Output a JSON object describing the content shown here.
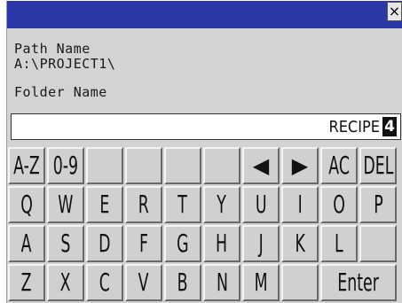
{
  "window": {
    "close_label": "×"
  },
  "path": {
    "label": "Path Name",
    "value": "A:\\PROJECT1\\"
  },
  "folder": {
    "label": "Folder Name",
    "input_value": "RECIPE",
    "cursor_char": "4"
  },
  "keyboard": {
    "rows": [
      [
        "A-Z",
        "0-9",
        "",
        "",
        "",
        "",
        "◀",
        "▶",
        "AC",
        "DEL"
      ],
      [
        "Q",
        "W",
        "E",
        "R",
        "T",
        "Y",
        "U",
        "I",
        "O",
        "P"
      ],
      [
        "A",
        "S",
        "D",
        "F",
        "G",
        "H",
        "J",
        "K",
        "L",
        ""
      ],
      [
        "Z",
        "X",
        "C",
        "V",
        "B",
        "N",
        "M",
        "",
        "Enter"
      ]
    ]
  }
}
